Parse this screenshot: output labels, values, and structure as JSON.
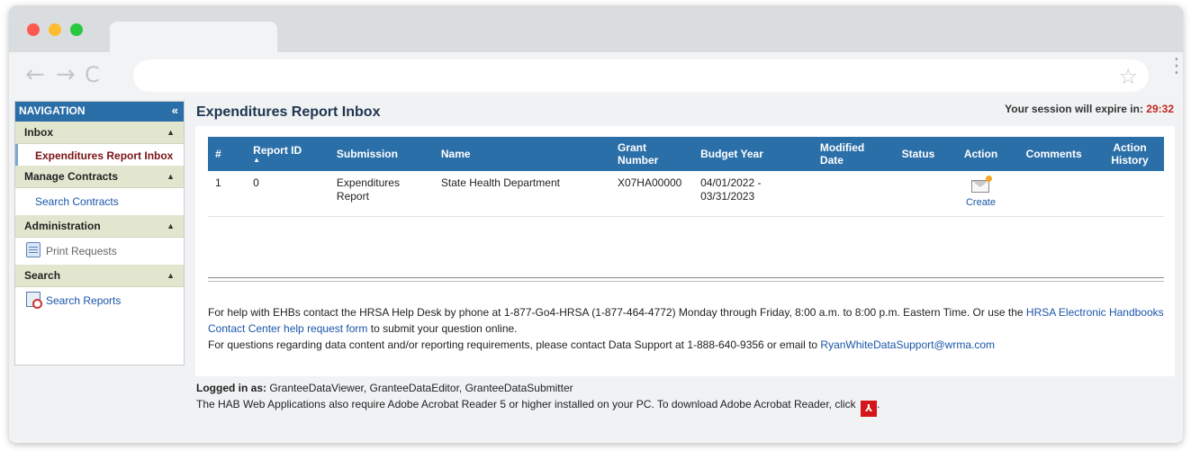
{
  "browser": {
    "back_icon": "←",
    "forward_icon": "→",
    "reload_icon": "C",
    "star_icon": "☆",
    "kebab_icon": "⋮"
  },
  "nav": {
    "header": "NAVIGATION",
    "collapse_icon": "«",
    "sections": [
      {
        "label": "Inbox",
        "items": [
          "Expenditures Report Inbox"
        ]
      },
      {
        "label": "Manage Contracts",
        "items": [
          "Search Contracts"
        ]
      },
      {
        "label": "Administration",
        "items": [
          "Print Requests"
        ]
      },
      {
        "label": "Search",
        "items": [
          "Search Reports"
        ]
      }
    ],
    "caret": "▲"
  },
  "main": {
    "title": "Expenditures Report Inbox",
    "session_label": "Your session will expire in: ",
    "session_timer": "29:32"
  },
  "table": {
    "headers": [
      "#",
      "Report ID",
      "Submission",
      "Name",
      "Grant Number",
      "Budget Year",
      "Modified Date",
      "Status",
      "Action",
      "Comments",
      "Action History"
    ],
    "sort_icon": "▲",
    "rows": [
      {
        "num": "1",
        "report_id": "0",
        "submission": "Expenditures Report",
        "name": "State Health Department",
        "grant_number": "X07HA00000",
        "budget_year": "04/01/2022 - 03/31/2023",
        "modified_date": "",
        "status": "",
        "action": "Create",
        "comments": "",
        "action_history": ""
      }
    ]
  },
  "help": {
    "line1_a": "For help with EHBs contact the HRSA Help Desk by phone at 1-877-Go4-HRSA (1-877-464-4772) Monday through Friday, 8:00 a.m. to 8:00 p.m. Eastern Time. Or use the ",
    "line1_link": "HRSA Electronic Handbooks Contact Center help request form",
    "line1_b": " to submit your question online.",
    "line2_a": "For questions regarding data content and/or reporting requirements, please contact Data Support at 1-888-640-9356 or email to ",
    "line2_link": "RyanWhiteDataSupport@wrma.com"
  },
  "footer": {
    "logged_label": "Logged in as:",
    "logged_value": " GranteeDataViewer, GranteeDataEditor, GranteeDataSubmitter",
    "acrobat_text": "The HAB Web Applications also require Adobe Acrobat Reader 5 or higher installed on your PC. To download Adobe Acrobat Reader, click ",
    "pdf_icon": "⅄",
    "end": "."
  }
}
